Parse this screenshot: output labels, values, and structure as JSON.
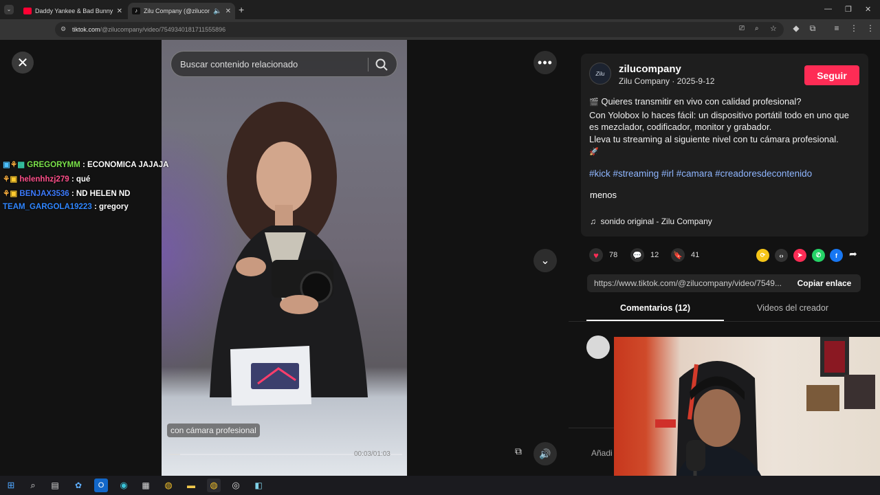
{
  "browser": {
    "tabs": [
      {
        "title": "Daddy Yankee & Bad Bunny - V",
        "active": false
      },
      {
        "title": "Zilu Company (@zilucompa",
        "active": true
      }
    ],
    "url_host": "tiktok.com",
    "url_path": "/@zilucompany/video/7549340181711555896"
  },
  "video": {
    "search_placeholder": "Buscar contenido relacionado",
    "caption": "con cámara profesional",
    "timecode": "00:03/01:03",
    "progress": 0.05
  },
  "chat": [
    {
      "user": "GREGORYMM",
      "text": ": ECONOMICA JAJAJA",
      "color": "#7be34a",
      "badges": true
    },
    {
      "user": "helenhhzj279",
      "text": ": qué",
      "color": "#ff4f8a",
      "badges": true
    },
    {
      "user": "BENJAX3536",
      "text": ": ND HELEN ND",
      "color": "#3d7cff",
      "badges": true
    },
    {
      "user": "TEAM_GARGOLA19223",
      "text": ": gregory",
      "color": "#2f86ff",
      "badges": false
    }
  ],
  "post": {
    "avatar_text": "Zilu",
    "username": "zilucompany",
    "display_name": "Zilu Company",
    "date": "2025-9-12",
    "follow_label": "Seguir",
    "description": [
      "Quieres transmitir en vivo con calidad profesional?",
      "Con Yolobox lo haces fácil: un dispositivo portátil todo en uno que es mezclador, codificador, monitor y grabador.",
      "Lleva tu streaming al siguiente nivel con tu cámara profesional."
    ],
    "hashtags": "#kick #streaming #irl #camara #creadoresdecontenido",
    "less_label": "menos",
    "music": "sonido original - Zilu Company",
    "likes": "78",
    "comments": "12",
    "saves": "41",
    "link": "https://www.tiktok.com/@zilucompany/video/7549...",
    "copy_label": "Copiar enlace",
    "tab_comments": "Comentarios (12)",
    "tab_creator": "Videos del creador",
    "add_comment": "Añadi"
  },
  "colors": {
    "accent": "#fe2c55",
    "hashtag": "#8fb6ff"
  }
}
